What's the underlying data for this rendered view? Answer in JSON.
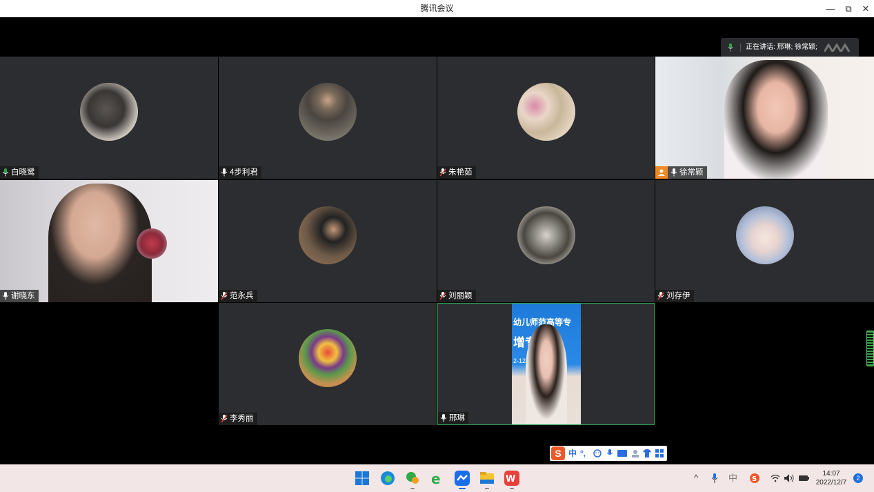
{
  "window": {
    "title": "腾讯会议",
    "minimize": "—",
    "restore": "⧉",
    "close": "✕"
  },
  "speaking": {
    "text": "正在讲话: 邢琳; 徐常颖;"
  },
  "participants": [
    {
      "name": "白晓鹭",
      "mic": "active"
    },
    {
      "name": "4步利君",
      "mic": "on"
    },
    {
      "name": "朱艳茹",
      "mic": "muted"
    },
    {
      "name": "徐常颖",
      "mic": "on",
      "host": true
    },
    {
      "name": "谢晓东",
      "mic": "on"
    },
    {
      "name": "范永兵",
      "mic": "muted"
    },
    {
      "name": "刘丽颖",
      "mic": "muted"
    },
    {
      "name": "刘存伊",
      "mic": "muted"
    },
    {
      "name": "李秀丽",
      "mic": "muted"
    },
    {
      "name": "邢琳",
      "mic": "on"
    }
  ],
  "screen_share": {
    "line1": "幼儿师范高等专",
    "line2": "增专",
    "line3": "2-12-"
  },
  "ime": {
    "logo": "S",
    "mode": "中",
    "punct": "°,"
  },
  "taskbar": {
    "tray": {
      "chevron": "^",
      "lang": "中"
    },
    "clock": {
      "time": "14:07",
      "date": "2022/12/7"
    },
    "notifications": "2"
  },
  "colors": {
    "tile_bg": "#2c2d30",
    "active_border": "#2fa24a",
    "accent_green": "#2fa24a",
    "muted_red": "#e0453a",
    "host_orange": "#f08a24"
  }
}
